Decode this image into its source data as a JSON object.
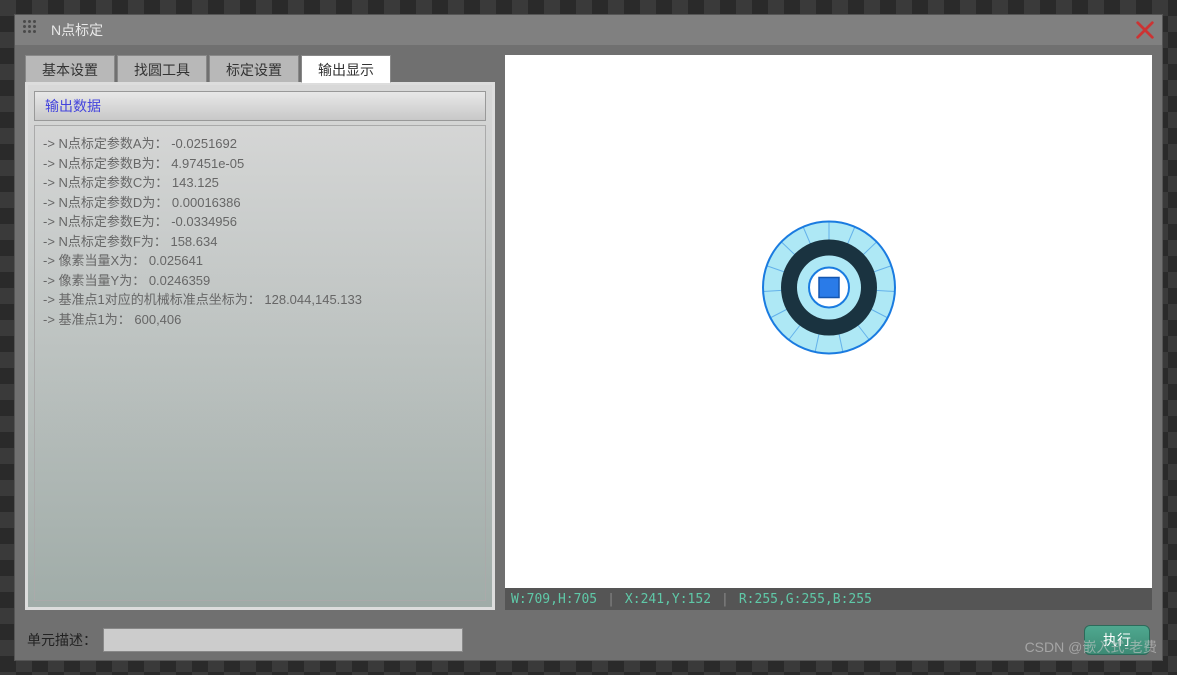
{
  "window": {
    "title": "N点标定"
  },
  "tabs": {
    "items": [
      {
        "label": "基本设置"
      },
      {
        "label": "找圆工具"
      },
      {
        "label": "标定设置"
      },
      {
        "label": "输出显示"
      }
    ],
    "active_index": 3
  },
  "output": {
    "group_title": "输出数据",
    "lines": [
      "->  N点标定参数A为： -0.0251692",
      "->  N点标定参数B为： 4.97451e-05",
      "->  N点标定参数C为： 143.125",
      "->  N点标定参数D为： 0.00016386",
      "->  N点标定参数E为： -0.0334956",
      "->  N点标定参数F为： 158.634",
      "->  像素当量X为： 0.025641",
      "->  像素当量Y为： 0.0246359",
      "->  基准点1对应的机械标准点坐标为： 128.044,145.133",
      "->  基准点1为： 600,406"
    ]
  },
  "status": {
    "wh": "W:709,H:705",
    "xy": "X:241,Y:152",
    "rgb": "R:255,G:255,B:255"
  },
  "bottom": {
    "desc_label": "单元描述：",
    "desc_value": "",
    "exec_label": "执行"
  },
  "watermark": "CSDN @嵌入式-老费",
  "colors": {
    "accent_teal": "#4fa88f",
    "status_text": "#5fc9a8",
    "link_blue": "#4444dd",
    "close_red": "#cc3333"
  }
}
